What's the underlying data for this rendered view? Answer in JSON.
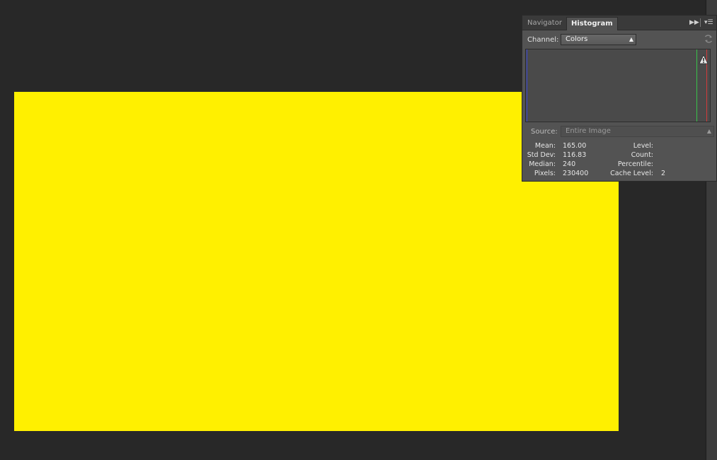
{
  "colors": {
    "document_fill": "#fff000",
    "histogram_blue": "#3a46d8",
    "histogram_green": "#38c24a",
    "histogram_red": "#d23a3a"
  },
  "histogram_panel": {
    "tabs": [
      "Navigator",
      "Histogram"
    ],
    "active_tab": "Histogram",
    "controls": {
      "collapse_icon": "double-arrow-right-icon",
      "menu_icon": "panel-menu-icon"
    },
    "channel": {
      "label": "Channel:",
      "value": "Colors"
    },
    "refresh_icon": "refresh-icon",
    "warning_icon": "cached-data-warning-icon",
    "source": {
      "label": "Source:",
      "value": "Entire Image"
    },
    "stats": {
      "mean_label": "Mean:",
      "mean": "165.00",
      "std_dev_label": "Std Dev:",
      "std_dev": "116.83",
      "median_label": "Median:",
      "median": "240",
      "pixels_label": "Pixels:",
      "pixels": "230400",
      "level_label": "Level:",
      "level": "",
      "count_label": "Count:",
      "count": "",
      "percentile_label": "Percentile:",
      "percentile": "",
      "cache_level_label": "Cache Level:",
      "cache_level": "2"
    }
  }
}
